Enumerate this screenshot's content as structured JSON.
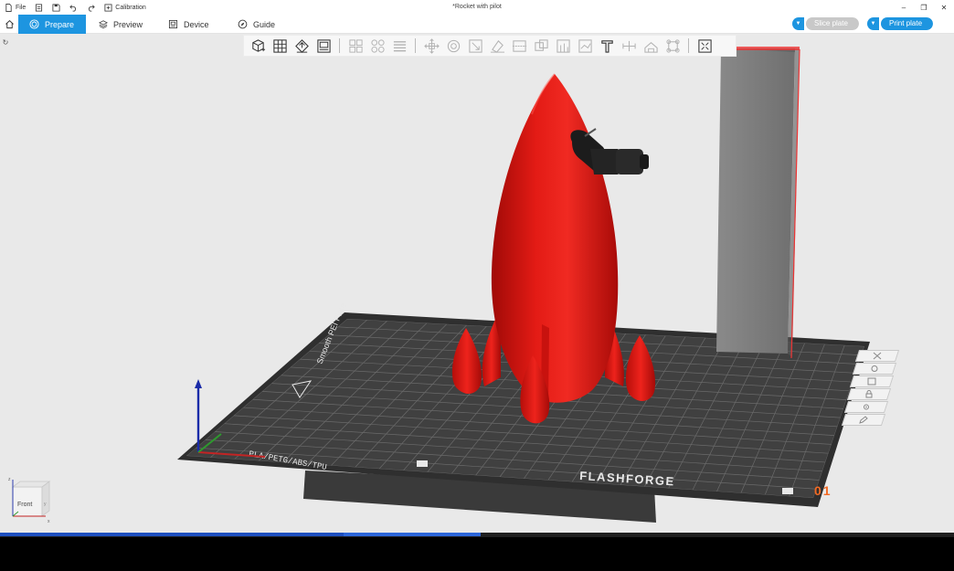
{
  "titlebar": {
    "file_label": "File",
    "calibration_label": "Calibration",
    "document_title": "*Rocket with pilot"
  },
  "tabs": [
    {
      "label": "Prepare",
      "icon": "cube-prepare-icon",
      "active": true
    },
    {
      "label": "Preview",
      "icon": "layers-icon",
      "active": false
    },
    {
      "label": "Device",
      "icon": "printer-device-icon",
      "active": false
    },
    {
      "label": "Guide",
      "icon": "compass-guide-icon",
      "active": false
    }
  ],
  "actions": {
    "slice_label": "Slice plate",
    "print_label": "Print plate"
  },
  "toolbar_tools": [
    "add-object-icon",
    "grid-arrange-icon",
    "orient-icon",
    "fit-view-icon",
    "split-objects-icon",
    "split-parts-icon",
    "layers-variable-icon",
    "move-icon",
    "rotate-icon",
    "scale-icon",
    "lay-on-face-icon",
    "cut-icon",
    "mesh-boolean-icon",
    "support-paint-icon",
    "seam-paint-icon",
    "text-emboss-icon",
    "measure-icon",
    "assembly-icon",
    "brim-ears-icon",
    "variable-layer-icon"
  ],
  "plate": {
    "brand_text": "FLASHFORGE",
    "material_text": "PLA/PETG/ABS/TPU",
    "plate_label": "Smooth PEI Plate",
    "plate_number": "01"
  },
  "view_cube": {
    "face_label": "Front",
    "axis_x": "x",
    "axis_y": "y",
    "axis_z": "z"
  },
  "colors": {
    "accent": "#1d95e0",
    "model": "#e31b15",
    "plate": "#3d3d3d",
    "plate_number": "#f26a24",
    "viewport_bg": "#e9e9e9",
    "slice_button_bg": "#c8c8c8",
    "print_button_bg": "#1d95e0"
  },
  "progress": {
    "fraction": 0.36
  }
}
